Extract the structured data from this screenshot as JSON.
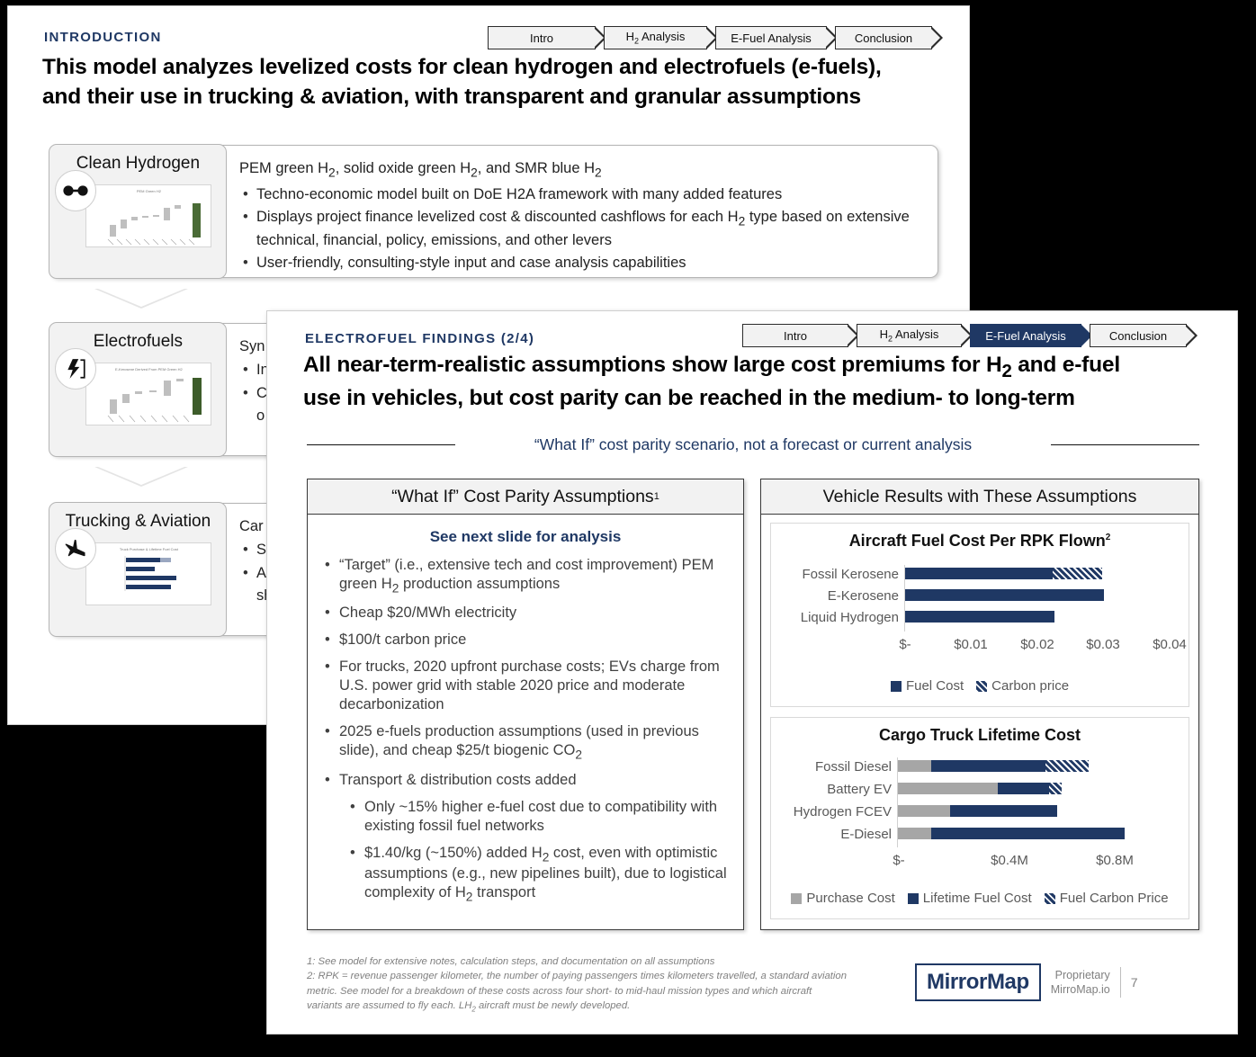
{
  "colors": {
    "navy": "#1F3864",
    "gray": "#A6A6A6",
    "panel_head_bg": "#F2F2F2",
    "muted": "#808080"
  },
  "back_slide": {
    "eyebrow": "INTRODUCTION",
    "headline_line1": "This model analyzes levelized costs for clean hydrogen and electrofuels (e-fuels),",
    "headline_line2": "and their use in trucking & aviation, with transparent and granular assumptions",
    "nav": [
      {
        "label": "Intro",
        "active": true
      },
      {
        "label": "H₂ Analysis",
        "active": false
      },
      {
        "label": "E-Fuel Analysis",
        "active": false
      },
      {
        "label": "Conclusion",
        "active": false
      }
    ],
    "sections": [
      {
        "title": "Clean Hydrogen",
        "icon": "molecule-icon",
        "thumb_title": "PEM Green H2",
        "lead": "PEM green H₂, solid oxide green H₂, and SMR blue H₂",
        "bullets": [
          "Techno-economic model built on DoE H2A framework with many added features",
          "Displays project finance levelized cost & discounted cashflows for each H₂ type based on extensive technical, financial, policy, emissions, and other levers",
          "User-friendly, consulting-style input and case analysis capabilities"
        ]
      },
      {
        "title": "Electrofuels",
        "icon": "lightning-icon",
        "thumb_title": "E-Kerosene Derived From PEM Green H2",
        "lead_visible": "Syn",
        "bullets_visible": [
          "In",
          "C",
          "o"
        ]
      },
      {
        "title": "Trucking & Aviation",
        "icon": "airplane-icon",
        "thumb_title": "Truck Purchase & Lifetime Fuel Cost",
        "lead_visible": "Car",
        "bullets_visible": [
          "Se",
          "A",
          "sh"
        ]
      }
    ]
  },
  "front_slide": {
    "eyebrow": "ELECTROFUEL FINDINGS (2/4)",
    "headline_line1": "All near-term-realistic assumptions show large cost premiums for H₂ and e-fuel",
    "headline_line2": "use in vehicles, but cost parity can be reached in the medium- to long-term",
    "divider_text": "“What If” cost parity scenario, not a forecast or current analysis",
    "nav": [
      {
        "label": "Intro",
        "active": false
      },
      {
        "label": "H₂ Analysis",
        "active": false
      },
      {
        "label": "E-Fuel Analysis",
        "active": true
      },
      {
        "label": "Conclusion",
        "active": false
      }
    ],
    "left_panel": {
      "header": "“What If” Cost Parity Assumptions",
      "header_sup": "1",
      "subhead": "See next slide for analysis",
      "bullets": [
        "“Target” (i.e., extensive tech and cost improvement) PEM green H₂ production assumptions",
        "Cheap $20/MWh electricity",
        "$100/t carbon price",
        "For trucks, 2020 upfront purchase costs; EVs charge from U.S. power grid with stable 2020 price and moderate decarbonization",
        "2025 e-fuels production assumptions (used in previous slide), and cheap $25/t biogenic CO₂",
        "Transport & distribution costs added"
      ],
      "sub_bullets": [
        "Only ~15% higher e-fuel cost due to compatibility with existing fossil fuel networks",
        "$1.40/kg (~150%) added H₂ cost, even with optimistic assumptions (e.g., new pipelines built), due to logistical complexity of H₂ transport"
      ]
    },
    "right_panel": {
      "header": "Vehicle Results with These Assumptions"
    },
    "footnotes": [
      "1: See model for extensive notes, calculation steps, and documentation on all assumptions",
      "2: RPK = revenue passenger kilometer, the number of paying passengers times kilometers travelled, a standard aviation metric. See model for a breakdown of these costs across four short- to mid-haul mission types and which aircraft variants are assumed to fly each. LH₂ aircraft must be newly developed."
    ],
    "logo": {
      "name": "MirrorMap",
      "line1": "Proprietary",
      "line2": "MirroMap.io",
      "page": "7"
    }
  },
  "chart_data": [
    {
      "type": "bar",
      "orientation": "horizontal",
      "stacked": true,
      "title": "Aircraft Fuel Cost Per RPK Flown",
      "title_sup": "2",
      "xlabel": "",
      "ylabel": "",
      "categories": [
        "Fossil Kerosene",
        "E-Kerosene",
        "Liquid Hydrogen"
      ],
      "tick_labels": [
        "$-",
        "$0.01",
        "$0.02",
        "$0.03",
        "$0.04"
      ],
      "tick_values": [
        0,
        0.01,
        0.02,
        0.03,
        0.04
      ],
      "xlim": [
        0,
        0.04
      ],
      "grid": false,
      "legend_position": "bottom",
      "series": [
        {
          "name": "Fuel Cost",
          "color": "#1F3864",
          "pattern": "solid",
          "values": [
            0.0223,
            0.03,
            0.0226
          ]
        },
        {
          "name": "Carbon price",
          "color": "#1F3864",
          "pattern": "hatch",
          "values": [
            0.007,
            0.0,
            0.0
          ]
        }
      ]
    },
    {
      "type": "bar",
      "orientation": "horizontal",
      "stacked": true,
      "title": "Cargo Truck Lifetime Cost",
      "xlabel": "",
      "ylabel": "",
      "categories": [
        "Fossil Diesel",
        "Battery EV",
        "Hydrogen FCEV",
        "E-Diesel"
      ],
      "tick_labels": [
        "$-",
        "$0.4M",
        "$0.8M"
      ],
      "tick_values": [
        0,
        0.4,
        0.8
      ],
      "xlim": [
        0,
        0.88
      ],
      "grid": false,
      "legend_position": "bottom",
      "series": [
        {
          "name": "Purchase Cost",
          "color": "#A6A6A6",
          "pattern": "solid",
          "values": [
            0.125,
            0.375,
            0.195,
            0.125
          ]
        },
        {
          "name": "Lifetime Fuel Cost",
          "color": "#1F3864",
          "pattern": "solid",
          "values": [
            0.43,
            0.195,
            0.405,
            0.73
          ]
        },
        {
          "name": "Fuel Carbon Price",
          "color": "#1F3864",
          "pattern": "hatch",
          "values": [
            0.165,
            0.048,
            0.0,
            0.0
          ]
        }
      ]
    }
  ]
}
